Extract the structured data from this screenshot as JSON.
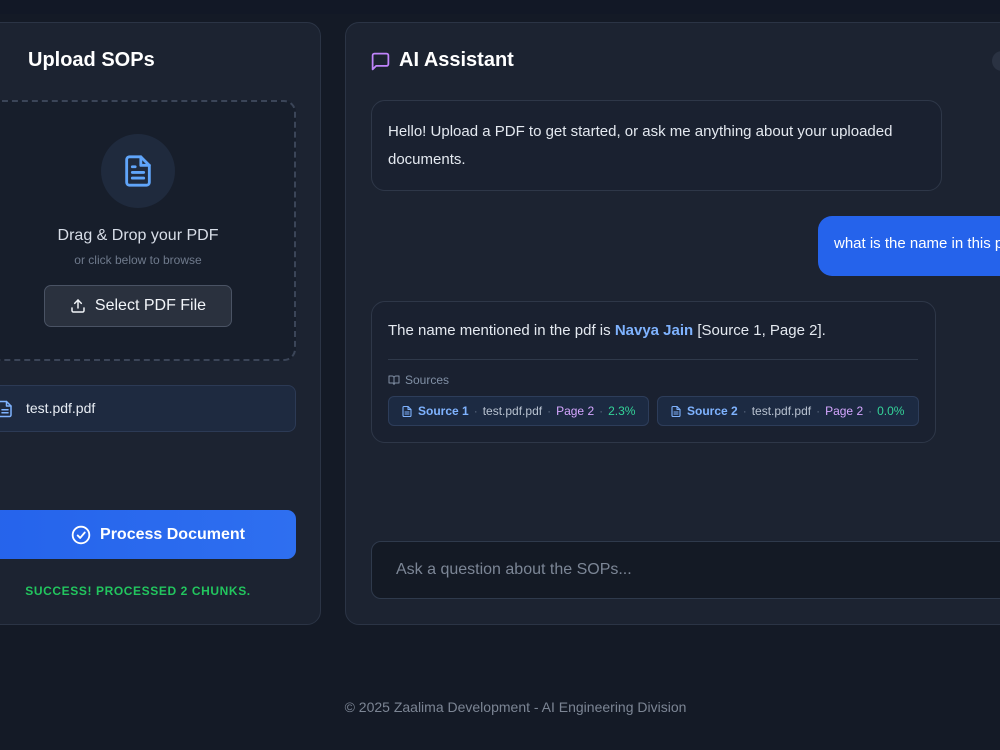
{
  "upload": {
    "title": "Upload SOPs",
    "drop_title": "Drag & Drop your PDF",
    "drop_subtitle": "or click below to browse",
    "select_button": "Select PDF File",
    "file_name": "test.pdf.pdf",
    "process_button": "Process Document",
    "status": "SUCCESS! PROCESSED 2 CHUNKS."
  },
  "assistant": {
    "title": "AI Assistant",
    "messages": [
      {
        "role": "bot",
        "text": "Hello! Upload a PDF to get started, or ask me anything about your uploaded documents."
      },
      {
        "role": "user",
        "text": "what is the name in this pdf"
      }
    ],
    "answer": {
      "prefix": "The name mentioned in the pdf is ",
      "highlight": "Navya Jain",
      "suffix": " [Source 1, Page 2]."
    },
    "sources_label": "Sources",
    "sources": [
      {
        "label": "Source 1",
        "file": "test.pdf.pdf",
        "page": "Page 2",
        "score": "2.3%"
      },
      {
        "label": "Source 2",
        "file": "test.pdf.pdf",
        "page": "Page 2",
        "score": "0.0%"
      }
    ],
    "input_placeholder": "Ask a question about the SOPs..."
  },
  "footer": "© 2025 Zaalima Development - AI Engineering Division",
  "colors": {
    "background": "#141a26",
    "panel": "#1c2331",
    "accent": "#2563eb",
    "success": "#22c55e",
    "highlight": "#7fb3ff",
    "assistant_icon": "#c084fc"
  },
  "icons": {
    "document": "document-icon",
    "upload": "upload-icon",
    "check": "check-circle-icon",
    "chat": "chat-bubble-icon",
    "book": "book-icon"
  }
}
